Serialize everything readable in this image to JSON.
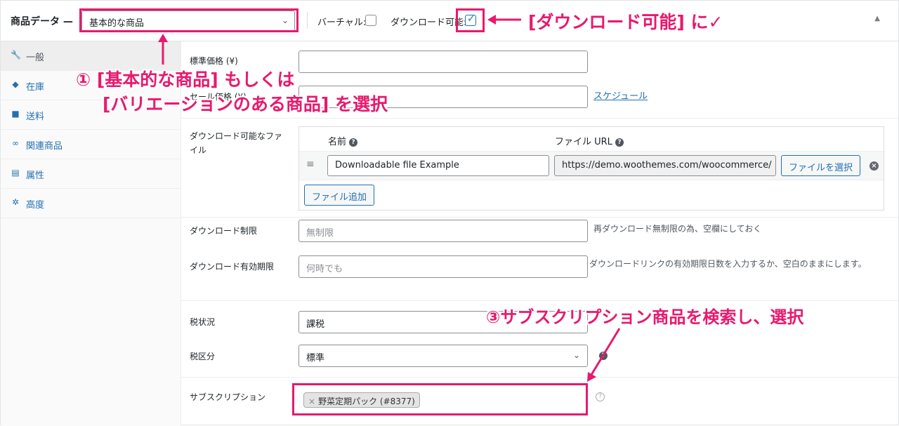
{
  "header": {
    "title": "商品データ —",
    "product_type": "基本的な商品",
    "virtual_label": "バーチャル:",
    "virtual_checked": false,
    "downloadable_label": "ダウンロード可能:",
    "downloadable_checked": true
  },
  "sidebar": {
    "items": [
      {
        "label": "一般",
        "icon": "wrench-icon",
        "active": true
      },
      {
        "label": "在庫",
        "icon": "tag-icon",
        "active": false
      },
      {
        "label": "送料",
        "icon": "truck-icon",
        "active": false
      },
      {
        "label": "関連商品",
        "icon": "link-icon",
        "active": false
      },
      {
        "label": "属性",
        "icon": "list-icon",
        "active": false
      },
      {
        "label": "高度",
        "icon": "gear-icon",
        "active": false
      }
    ]
  },
  "general": {
    "regular_price_label": "標準価格 (¥)",
    "regular_price_value": "",
    "sale_price_label": "セール価格 (¥)",
    "sale_price_value": "",
    "schedule_link": "スケジュール",
    "downloadable_files_label": "ダウンロード可能なファイル",
    "files_table": {
      "col_name": "名前",
      "col_url": "ファイル URL",
      "rows": [
        {
          "name": "Downloadable file Example",
          "url": "https://demo.woothemes.com/woocommerce/",
          "choose_button": "ファイルを選択"
        }
      ],
      "add_button": "ファイル追加"
    },
    "download_limit_label": "ダウンロード制限",
    "download_limit_placeholder": "無制限",
    "download_limit_desc": "再ダウンロード無制限の為、空欄にしておく",
    "download_expiry_label": "ダウンロード有効期限",
    "download_expiry_placeholder": "何時でも",
    "download_expiry_desc": "ダウンロードリンクの有効期限日数を入力するか、空白のままにします。",
    "tax_status_label": "税状況",
    "tax_status_value": "課税",
    "tax_class_label": "税区分",
    "tax_class_value": "標準",
    "subscription_label": "サブスクリプション",
    "subscription_chip": "野菜定期パック (#8377)"
  },
  "annotations": {
    "step1_line1": "① [基本的な商品] もしくは",
    "step1_line2": "[バリエーションのある商品] を選択",
    "step2": "[ダウンロード可能] に✓",
    "step3": "③サブスクリプション商品を検索し、選択",
    "color": "#e8196e"
  }
}
